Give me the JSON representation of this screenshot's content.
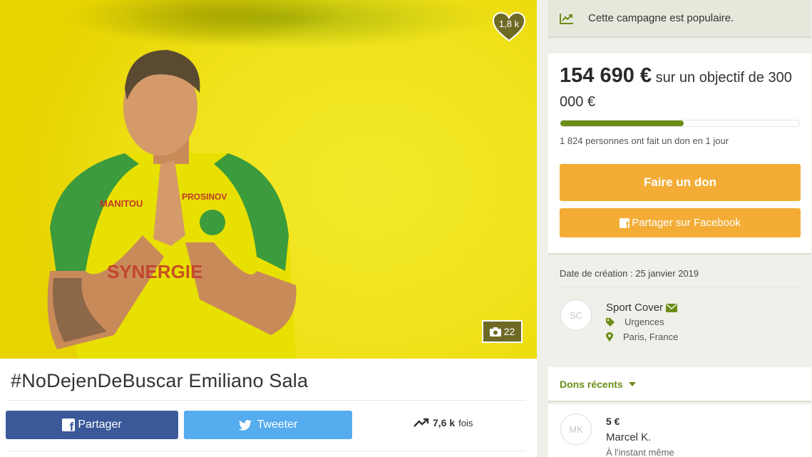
{
  "campaign": {
    "title": "#NoDejenDeBuscar Emiliano Sala",
    "likes": "1,8 k",
    "photo_count": "22"
  },
  "share": {
    "facebook_label": "Partager",
    "twitter_label": "Tweeter",
    "shares_count": "7,6 k",
    "shares_suffix": "fois"
  },
  "sidebar": {
    "popular_text": "Cette campagne est populaire.",
    "amount": "154 690 €",
    "goal_text": "sur un objectif de",
    "goal_amount": "300 000 €",
    "progress_fraction": 0.5156,
    "donors_text": "1 824 personnes ont fait un don en 1 jour",
    "donate_label": "Faire un don",
    "fb_share_label": "Partager sur Facebook",
    "created_text": "Date de création : 25 janvier 2019",
    "organizer": {
      "initials": "SC",
      "name": "Sport Cover",
      "category": "Urgences",
      "location": "Paris, France"
    },
    "recent_label": "Dons récents",
    "recent_donation": {
      "initials": "MK",
      "amount": "5 €",
      "name": "Marcel K.",
      "time": "À l'instant même"
    }
  },
  "colors": {
    "green": "#6c8d17",
    "orange": "#f3ad36",
    "facebook": "#3b5998",
    "twitter": "#55acee"
  }
}
